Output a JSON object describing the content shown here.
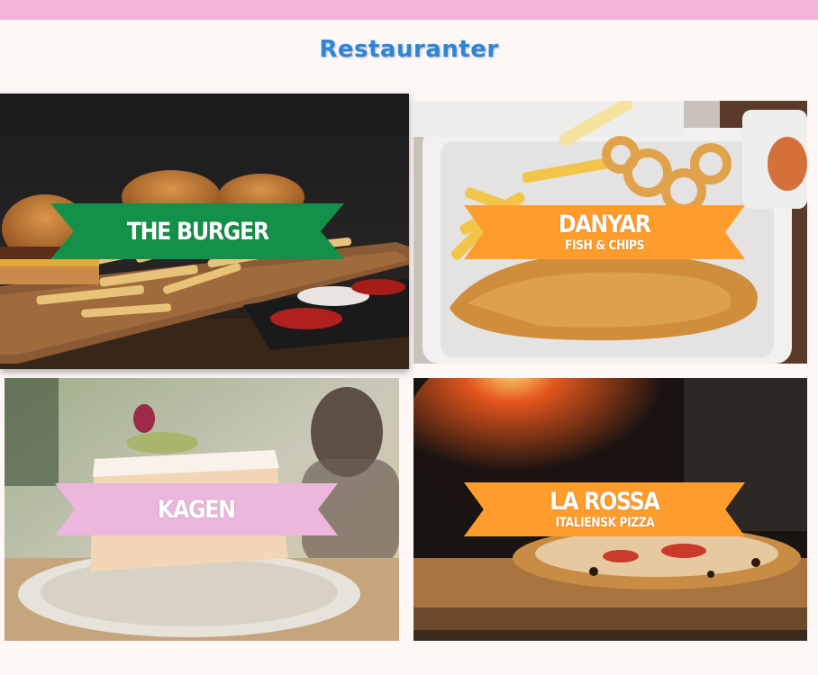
{
  "header": {
    "title": "Restauranter",
    "bar_color": "#f1b6d9",
    "title_color": "#2e85d6"
  },
  "restaurants": [
    {
      "name": "THE BURGER",
      "subtitle": "",
      "banner_color": "#13904a",
      "image": "burger-photo"
    },
    {
      "name": "DANYAR",
      "subtitle": "FISH & CHIPS",
      "banner_color": "#ff9d2c",
      "image": "fish-and-chips-photo"
    },
    {
      "name": "KAGEN",
      "subtitle": "",
      "banner_color": "#ecb7dc",
      "image": "cake-photo"
    },
    {
      "name": "LA ROSSA",
      "subtitle": "ITALIENSK PIZZA",
      "banner_color": "#ff9d2c",
      "image": "pizza-photo"
    }
  ]
}
